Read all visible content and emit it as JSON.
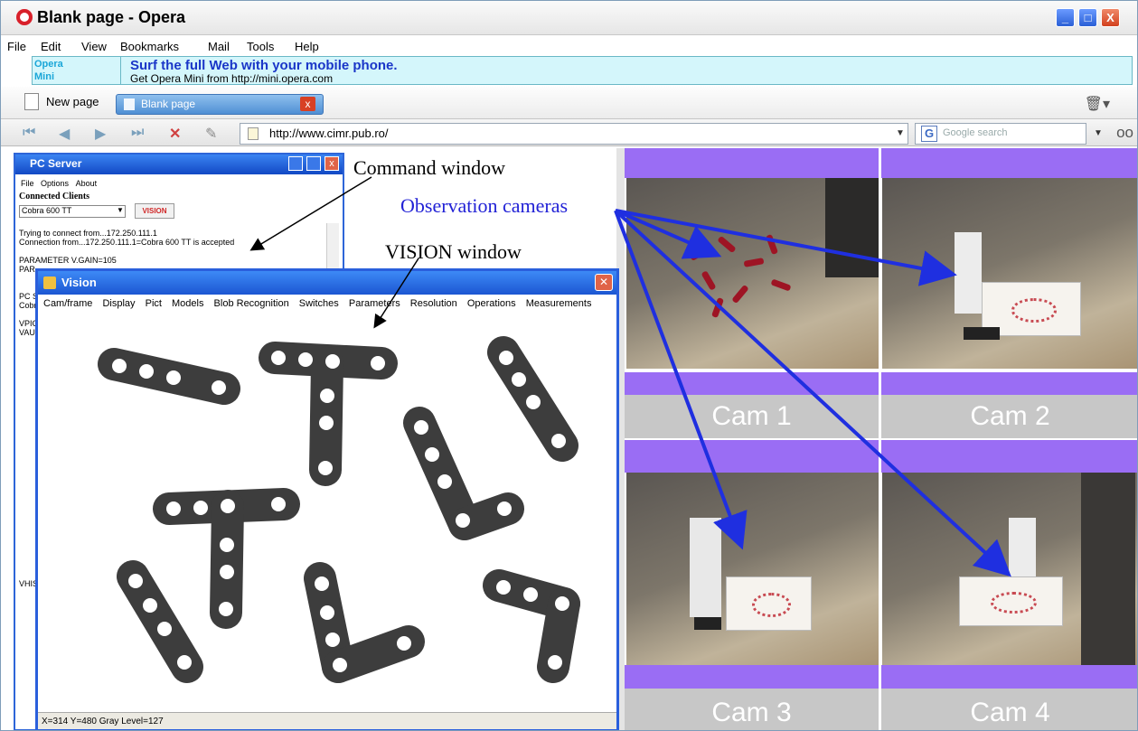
{
  "window": {
    "title": "Blank page - Opera",
    "minimize": "_",
    "maximize": "□",
    "close": "X"
  },
  "menu": [
    "File",
    "Edit",
    "View",
    "Bookmarks",
    "Mail",
    "Tools",
    "Help"
  ],
  "ad": {
    "brand_line1": "Opera",
    "brand_line2": "Mini",
    "headline": "Surf the full Web with your mobile phone.",
    "subline": "Get Opera Mini from http://mini.opera.com"
  },
  "tabs": {
    "new_page": "New page",
    "active_tab": "Blank page",
    "close": "x"
  },
  "address": {
    "url": "http://www.cimr.pub.ro/",
    "search_placeholder": "Google search"
  },
  "pc_server": {
    "title": "PC Server",
    "menu": [
      "File",
      "Options",
      "About"
    ],
    "connected_clients": "Connected Clients",
    "client_selected": "Cobra 600 TT",
    "vision_button": "VISION",
    "log": [
      "Trying to connect from...172.250.111.1",
      "Connection from...172.250.111.1=Cobra 600 TT is accepted",
      "",
      "PARAMETER V.GAIN=105",
      "PAR",
      "",
      "",
      "PC S",
      "Cobr",
      "",
      "VPIC",
      "VAUT"
    ],
    "bottom_label": "VHIS"
  },
  "annotations": {
    "command": "Command window",
    "observation": "Observation cameras",
    "vision": "VISION window"
  },
  "vision": {
    "title": "Vision",
    "menu": [
      "Cam/frame",
      "Display",
      "Pict",
      "Models",
      "Blob Recognition",
      "Switches",
      "Parameters",
      "Resolution",
      "Operations",
      "Measurements"
    ],
    "status": "X=314 Y=480 Gray Level=127"
  },
  "cameras": [
    {
      "label": "Cam 1"
    },
    {
      "label": "Cam 2"
    },
    {
      "label": "Cam 3"
    },
    {
      "label": "Cam 4"
    }
  ],
  "colors": {
    "arrow": "#1f2fe0",
    "camera_band": "#9a6df4",
    "part": "#3d3d3d"
  }
}
